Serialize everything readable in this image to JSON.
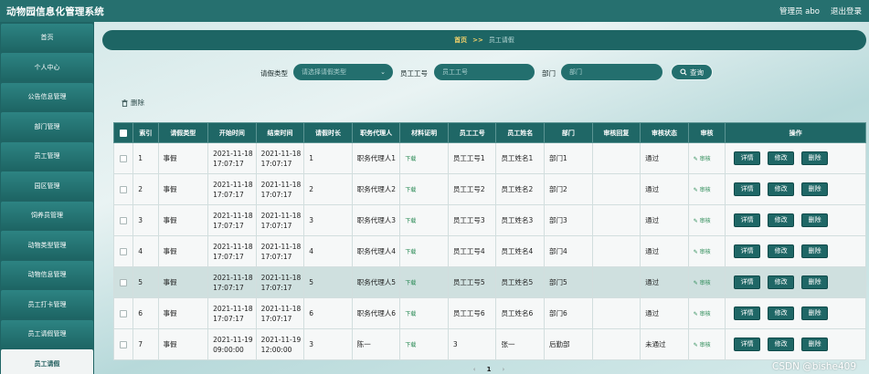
{
  "app": {
    "title": "动物园信息化管理系统"
  },
  "topbar": {
    "user": "管理员 abo",
    "logout": "退出登录"
  },
  "sidebar": {
    "items": [
      {
        "label": "首页"
      },
      {
        "label": "个人中心"
      },
      {
        "label": "公告信息管理"
      },
      {
        "label": "部门管理"
      },
      {
        "label": "员工管理"
      },
      {
        "label": "园区管理"
      },
      {
        "label": "饲养员管理"
      },
      {
        "label": "动物类型管理"
      },
      {
        "label": "动物信息管理"
      },
      {
        "label": "员工打卡管理"
      },
      {
        "label": "员工请假管理"
      },
      {
        "label": "员工请假",
        "active": true
      }
    ]
  },
  "breadcrumb": {
    "home": "首页",
    "separator": ">>",
    "current": "员工请假"
  },
  "search": {
    "type_label": "请假类型",
    "type_placeholder": "请选择请假类型",
    "emp_label": "员工工号",
    "emp_placeholder": "员工工号",
    "dept_label": "部门",
    "dept_placeholder": "部门",
    "button": "查询",
    "search_icon": "search-icon"
  },
  "toolbar": {
    "delete_label": "删除",
    "delete_icon": "trash-icon"
  },
  "table": {
    "headers": [
      "索引",
      "请假类型",
      "开始时间",
      "结束时间",
      "请假时长",
      "职务代理人",
      "材料证明",
      "员工工号",
      "员工姓名",
      "部门",
      "审核回复",
      "审核状态",
      "审核",
      "操作"
    ],
    "rows": [
      {
        "index": "1",
        "type": "事假",
        "start": "2021-11-18 17:07:17",
        "end": "2021-11-18 17:07:17",
        "duration": "1",
        "agent": "职务代理人1",
        "proof": "下载",
        "emp_no": "员工工号1",
        "emp_name": "员工姓名1",
        "dept": "部门1",
        "reply": "",
        "status": "通过",
        "audit": "审核"
      },
      {
        "index": "2",
        "type": "事假",
        "start": "2021-11-18 17:07:17",
        "end": "2021-11-18 17:07:17",
        "duration": "2",
        "agent": "职务代理人2",
        "proof": "下载",
        "emp_no": "员工工号2",
        "emp_name": "员工姓名2",
        "dept": "部门2",
        "reply": "",
        "status": "通过",
        "audit": "审核"
      },
      {
        "index": "3",
        "type": "事假",
        "start": "2021-11-18 17:07:17",
        "end": "2021-11-18 17:07:17",
        "duration": "3",
        "agent": "职务代理人3",
        "proof": "下载",
        "emp_no": "员工工号3",
        "emp_name": "员工姓名3",
        "dept": "部门3",
        "reply": "",
        "status": "通过",
        "audit": "审核"
      },
      {
        "index": "4",
        "type": "事假",
        "start": "2021-11-18 17:07:17",
        "end": "2021-11-18 17:07:17",
        "duration": "4",
        "agent": "职务代理人4",
        "proof": "下载",
        "emp_no": "员工工号4",
        "emp_name": "员工姓名4",
        "dept": "部门4",
        "reply": "",
        "status": "通过",
        "audit": "审核"
      },
      {
        "index": "5",
        "type": "事假",
        "start": "2021-11-18 17:07:17",
        "end": "2021-11-18 17:07:17",
        "duration": "5",
        "agent": "职务代理人5",
        "proof": "下载",
        "emp_no": "员工工号5",
        "emp_name": "员工姓名5",
        "dept": "部门5",
        "reply": "",
        "status": "通过",
        "audit": "审核"
      },
      {
        "index": "6",
        "type": "事假",
        "start": "2021-11-18 17:07:17",
        "end": "2021-11-18 17:07:17",
        "duration": "6",
        "agent": "职务代理人6",
        "proof": "下载",
        "emp_no": "员工工号6",
        "emp_name": "员工姓名6",
        "dept": "部门6",
        "reply": "",
        "status": "通过",
        "audit": "审核"
      },
      {
        "index": "7",
        "type": "事假",
        "start": "2021-11-19 09:00:00",
        "end": "2021-11-19 12:00:00",
        "duration": "3",
        "agent": "陈一",
        "proof": "下载",
        "emp_no": "3",
        "emp_name": "张一",
        "dept": "后勤部",
        "reply": "",
        "status": "未通过",
        "audit": "审核"
      }
    ],
    "actions": {
      "detail": "详情",
      "edit": "修改",
      "delete": "删除"
    }
  },
  "pagination": {
    "prev": "‹",
    "current": "1",
    "next": "›"
  },
  "watermark": "CSDN @bishe409",
  "colors": {
    "primary": "#1f6766",
    "topbar": "#26706f",
    "accent": "#f5d36a",
    "link": "#2a8a55"
  }
}
